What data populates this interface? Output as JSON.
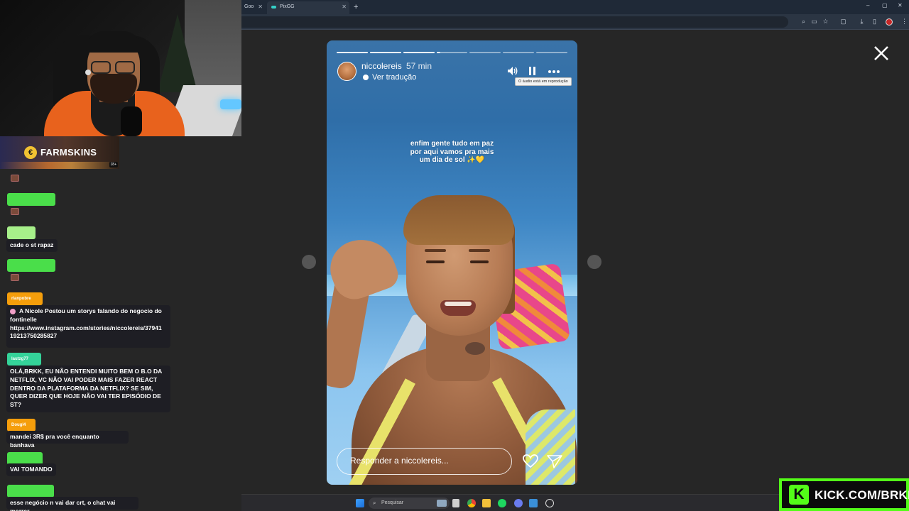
{
  "browser": {
    "tabs": [
      {
        "label": "Goo"
      },
      {
        "label": "PixGG"
      }
    ],
    "new_tab": "+",
    "window_controls": [
      "–",
      "▢",
      "✕"
    ]
  },
  "overlay": {
    "sponsor_name": "FARMSKINS",
    "sponsor_badge": "18+",
    "kick_logo": "K",
    "kick_text": "KICK.COM/BRKK"
  },
  "chat": {
    "messages": [
      {
        "user": "",
        "user_color": "#4ade4a",
        "text": "",
        "emote": true
      },
      {
        "user": "",
        "user_color": "#4ade4a",
        "text": "",
        "emote": true
      },
      {
        "user": "",
        "user_color": "#a7f08a",
        "text": "cade o st rapaz"
      },
      {
        "user": "",
        "user_color": "#4ade4a",
        "text": "",
        "emote": true
      },
      {
        "user": "rlanpobre",
        "user_color": "#f59e0b",
        "text_lines": [
          "A Nicole Postou um storys falando do negocio do fontinelle",
          "https://www.instagram.com/stories/niccolereis/37941",
          "19213750285827"
        ],
        "heart": true
      },
      {
        "user": "lautzg77",
        "user_color": "#34d399",
        "text_lines": [
          "OLÁ,BRKK, EU NÃO ENTENDI MUITO BEM O B.O DA",
          "NETFLIX, VC NÃO VAI PODER MAIS FAZER REACT",
          "DENTRO DA PLATAFORMA DA NETFLIX? SE SIM,",
          "QUER DIZER QUE HOJE NÃO VAI TER EPISÓDIO DE",
          "ST?"
        ]
      },
      {
        "user": "Dougl4",
        "user_color": "#f59e0b",
        "text": "mandei 3R$ pra você enquanto banhava"
      },
      {
        "user": "",
        "user_color": "#4ade4a",
        "text": "VAI TOMANDO"
      },
      {
        "user": "",
        "user_color": "#4ade4a",
        "text": "esse negócio n vai dar crt, o chat vai morrer"
      }
    ]
  },
  "story": {
    "username": "niccolereis",
    "time_ago": "57 min",
    "translate_label": "Ver tradução",
    "audio_tooltip": "O áudio está em reprodução",
    "caption_lines": [
      "enfim gente tudo em paz",
      "por aqui vamos pra mais",
      "um dia de sol ✨💛"
    ],
    "reply_placeholder": "Responder a niccolereis...",
    "progress": {
      "segments": 7,
      "completed": 3,
      "current_fraction": 0.1
    },
    "icons": {
      "sound": "speaker-icon",
      "pause": "pause-icon",
      "more": "more-icon",
      "like": "heart-icon",
      "share": "send-icon",
      "close": "close-icon",
      "prev": "chevron-left-icon",
      "next": "chevron-right-icon"
    }
  },
  "taskbar": {
    "search_label": "Pesquisar"
  }
}
